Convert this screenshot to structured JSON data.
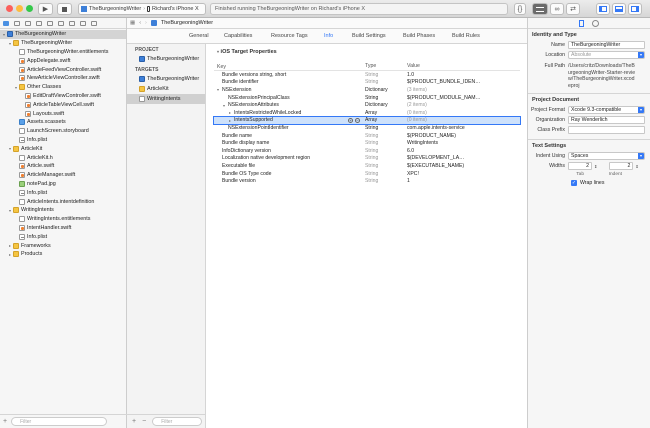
{
  "toolbar": {
    "scheme_target": "TheBurgeoningWriter",
    "scheme_device": "Richard's iPhone X",
    "activity_status": "Finished running TheBurgeoningWriter on Richard's iPhone X"
  },
  "navigator": {
    "filter_placeholder": "Filter",
    "tree": [
      {
        "label": "TheBurgeoningWriter",
        "indent": 0,
        "arrow": "▾",
        "icon": "proj",
        "selected": true
      },
      {
        "label": "TheBurgeoningWriter",
        "indent": 1,
        "arrow": "▾",
        "icon": "folder"
      },
      {
        "label": "TheBurgeoningWriter.entitlements",
        "indent": 2,
        "arrow": "",
        "icon": "file"
      },
      {
        "label": "AppDelegate.swift",
        "indent": 2,
        "arrow": "",
        "icon": "swift"
      },
      {
        "label": "ArticleFeedViewController.swift",
        "indent": 2,
        "arrow": "",
        "icon": "swift"
      },
      {
        "label": "NewArticleViewController.swift",
        "indent": 2,
        "arrow": "",
        "icon": "swift"
      },
      {
        "label": "Other Classes",
        "indent": 2,
        "arrow": "▾",
        "icon": "folder"
      },
      {
        "label": "EditDraftViewController.swift",
        "indent": 3,
        "arrow": "",
        "icon": "swift"
      },
      {
        "label": "ArticleTableViewCell.swift",
        "indent": 3,
        "arrow": "",
        "icon": "swift"
      },
      {
        "label": "Layouts.swift",
        "indent": 3,
        "arrow": "",
        "icon": "swift"
      },
      {
        "label": "Assets.xcassets",
        "indent": 2,
        "arrow": "",
        "icon": "img"
      },
      {
        "label": "LaunchScreen.storyboard",
        "indent": 2,
        "arrow": "",
        "icon": "file"
      },
      {
        "label": "Info.plist",
        "indent": 2,
        "arrow": "",
        "icon": "plist"
      },
      {
        "label": "ArticleKit",
        "indent": 1,
        "arrow": "▾",
        "icon": "folder"
      },
      {
        "label": "ArticleKit.h",
        "indent": 2,
        "arrow": "",
        "icon": "file"
      },
      {
        "label": "Article.swift",
        "indent": 2,
        "arrow": "",
        "icon": "swift"
      },
      {
        "label": "ArticleManager.swift",
        "indent": 2,
        "arrow": "",
        "icon": "swift"
      },
      {
        "label": "notePad.jpg",
        "indent": 2,
        "arrow": "",
        "icon": "media"
      },
      {
        "label": "Info.plist",
        "indent": 2,
        "arrow": "",
        "icon": "plist"
      },
      {
        "label": "ArticleIntents.intentdefinition",
        "indent": 2,
        "arrow": "",
        "icon": "file"
      },
      {
        "label": "WritingIntents",
        "indent": 1,
        "arrow": "▾",
        "icon": "folder"
      },
      {
        "label": "WritingIntents.entitlements",
        "indent": 2,
        "arrow": "",
        "icon": "file"
      },
      {
        "label": "IntentHandler.swift",
        "indent": 2,
        "arrow": "",
        "icon": "swift"
      },
      {
        "label": "Info.plist",
        "indent": 2,
        "arrow": "",
        "icon": "plist"
      },
      {
        "label": "Frameworks",
        "indent": 1,
        "arrow": "▸",
        "icon": "folder"
      },
      {
        "label": "Products",
        "indent": 1,
        "arrow": "▸",
        "icon": "folder"
      }
    ]
  },
  "editor": {
    "jump_bar": "TheBurgeoningWriter",
    "tabs": [
      "General",
      "Capabilities",
      "Resource Tags",
      "Info",
      "Build Settings",
      "Build Phases",
      "Build Rules"
    ],
    "active_tab": "Info",
    "project_header": "PROJECT",
    "project_item": "TheBurgeoningWriter",
    "targets_header": "TARGETS",
    "targets": [
      {
        "label": "TheBurgeoningWriter",
        "icon": "proj"
      },
      {
        "label": "ArticleKit",
        "icon": "folder"
      },
      {
        "label": "WritingIntents",
        "icon": "file",
        "selected": true
      }
    ],
    "section_title": "iOS Target Properties",
    "columns": {
      "key": "Key",
      "type": "Type",
      "value": "Value"
    },
    "rows": [
      {
        "key": "Bundle versions string, short",
        "type": "String",
        "value": "1.0",
        "indent": 0,
        "arrow": "",
        "dim": true
      },
      {
        "key": "Bundle identifier",
        "type": "String",
        "value": "$(PRODUCT_BUNDLE_IDEN…",
        "indent": 0,
        "arrow": "",
        "dim": true
      },
      {
        "key": "NSExtension",
        "type": "Dictionary",
        "value": "(3 items)",
        "indent": 0,
        "arrow": "▾",
        "dim": false
      },
      {
        "key": "NSExtensionPrincipalClass",
        "type": "String",
        "value": "$(PRODUCT_MODULE_NAM…",
        "indent": 1,
        "arrow": "",
        "dim": false
      },
      {
        "key": "NSExtensionAttributes",
        "type": "Dictionary",
        "value": "(2 items)",
        "indent": 1,
        "arrow": "▾",
        "dim": false
      },
      {
        "key": "IntentsRestrictedWhileLocked",
        "type": "Array",
        "value": "(0 items)",
        "indent": 2,
        "arrow": "▸",
        "dim": false
      },
      {
        "key": "IntentsSupported",
        "type": "Array",
        "value": "(0 items)",
        "indent": 2,
        "arrow": "▸",
        "dim": false,
        "selected": true
      },
      {
        "key": "NSExtensionPointIdentifier",
        "type": "String",
        "value": "com.apple.intents-service",
        "indent": 1,
        "arrow": "",
        "dim": false
      },
      {
        "key": "Bundle name",
        "type": "String",
        "value": "$(PRODUCT_NAME)",
        "indent": 0,
        "arrow": "",
        "dim": true
      },
      {
        "key": "Bundle display name",
        "type": "String",
        "value": "WritingIntents",
        "indent": 0,
        "arrow": "",
        "dim": true
      },
      {
        "key": "InfoDictionary version",
        "type": "String",
        "value": "6.0",
        "indent": 0,
        "arrow": "",
        "dim": true
      },
      {
        "key": "Localization native development region",
        "type": "String",
        "value": "$(DEVELOPMENT_LA…",
        "indent": 0,
        "arrow": "",
        "dim": true
      },
      {
        "key": "Executable file",
        "type": "String",
        "value": "$(EXECUTABLE_NAME)",
        "indent": 0,
        "arrow": "",
        "dim": true
      },
      {
        "key": "Bundle OS Type code",
        "type": "String",
        "value": "XPC!",
        "indent": 0,
        "arrow": "",
        "dim": true
      },
      {
        "key": "Bundle version",
        "type": "String",
        "value": "1",
        "indent": 0,
        "arrow": "",
        "dim": true
      }
    ]
  },
  "inspector": {
    "identity_header": "Identity and Type",
    "name_label": "Name",
    "name_value": "TheBurgeoningWriter",
    "location_label": "Location",
    "location_value": "Absolute",
    "full_path_label": "Full Path",
    "full_path_value": "/Users/critz/Downloads/TheBurgeoningWriter-Starter-review/TheBurgeoningWriter.xcodeproj",
    "project_doc_header": "Project Document",
    "project_format_label": "Project Format",
    "project_format_value": "Xcode 9.3-compatible",
    "organization_label": "Organization",
    "organization_value": "Ray Wenderlich",
    "class_prefix_label": "Class Prefix",
    "class_prefix_value": "",
    "text_settings_header": "Text Settings",
    "indent_using_label": "Indent Using",
    "indent_using_value": "Spaces",
    "widths_label": "Widths",
    "tab_width": "2",
    "indent_width": "2",
    "tab_label": "Tab",
    "indent_label": "Indent",
    "wrap_lines_label": "Wrap lines",
    "wrap_lines_checked": true
  },
  "colors": {
    "accent": "#3478f6",
    "folder": "#f5c542",
    "selection": "#cde1fb"
  }
}
